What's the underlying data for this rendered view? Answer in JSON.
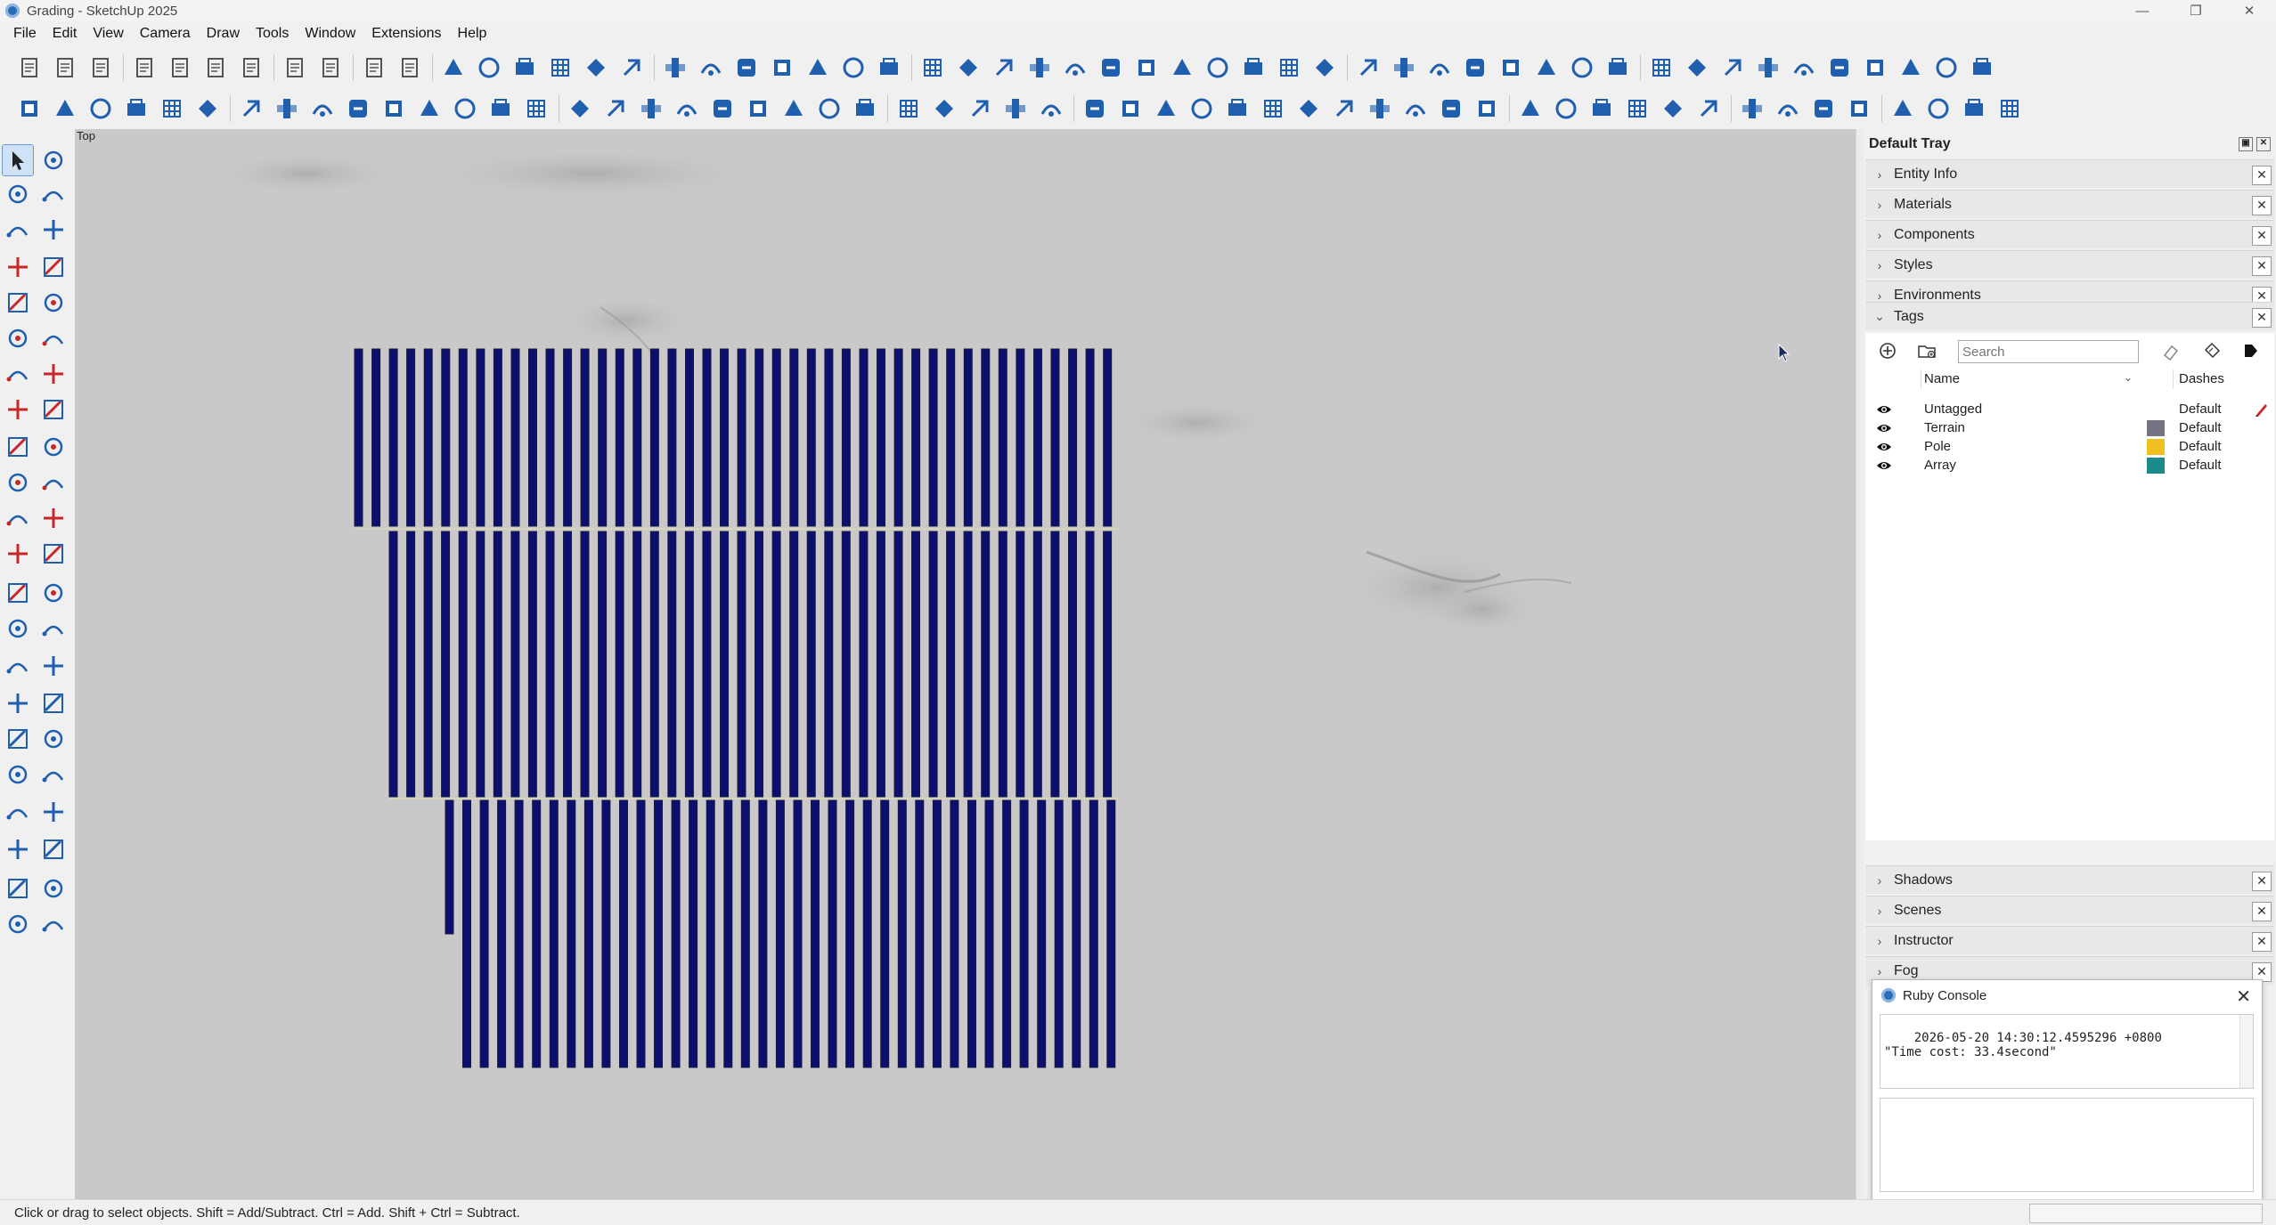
{
  "window": {
    "title": "Grading - SketchUp 2025",
    "minimize": "—",
    "restore": "❐",
    "close": "✕"
  },
  "menu": [
    "File",
    "Edit",
    "View",
    "Camera",
    "Draw",
    "Tools",
    "Window",
    "Extensions",
    "Help"
  ],
  "toolbar1_icons": [
    "new-file-icon",
    "open-icon",
    "save-icon",
    "|",
    "cut-icon",
    "copy-icon",
    "paste-icon",
    "erase-icon",
    "|",
    "undo-icon",
    "redo-icon",
    "|",
    "print-icon",
    "model-info-icon",
    "|",
    "iso-view-icon",
    "top-view-icon",
    "front-view-icon",
    "right-view-icon",
    "back-view-icon",
    "left-view-icon",
    "|",
    "xray-icon",
    "back-edges-icon",
    "wireframe-icon",
    "hidden-line-icon",
    "shaded-icon",
    "shaded-textures-icon",
    "monochrome-icon",
    "|",
    "house-icon",
    "text-icon",
    "tree-icon",
    "tree2-icon",
    "windmill-icon",
    "tower-icon",
    "box-icon",
    "grid-icon",
    "frame-icon",
    "resize-icon",
    "hide-icon",
    "pyramid-icon",
    "|",
    "search-icon",
    "angle-icon",
    "dimension-icon",
    "tape-icon",
    "swap-icon",
    "list-icon",
    "lock-icon",
    "slope-icon",
    "|",
    "terrain-icon",
    "vehicle-icon",
    "table-icon",
    "road-icon",
    "snow-icon",
    "split-icon",
    "auto-icon",
    "flow-icon",
    "map-icon",
    "map2-icon"
  ],
  "toolbar2_icons": [
    "menu-icon",
    "sun-icon",
    "globe-icon",
    "area-icon",
    "mountain-icon",
    "mountains-icon",
    "|",
    "panel-icon",
    "panel2-icon",
    "grid-panel-icon",
    "panel3-icon",
    "trash-icon",
    "percent-icon",
    "wand-icon",
    "wand2-icon",
    "pipe-icon",
    "|",
    "grid2-icon",
    "chip-icon",
    "cable-icon",
    "zoom-pan-icon",
    "wave-icon",
    "zoom-search-icon",
    "earth-icon",
    "link-icon",
    "barcode-icon",
    "|",
    "axis-icon",
    "layers-icon",
    "add-box-icon",
    "cloud-cad-icon",
    "ruler-icon",
    "|",
    "flow-chart-icon",
    "image-edit-icon",
    "pointer-icon",
    "move-cross-icon",
    "calculator-icon",
    "sliders-icon",
    "dropbox-icon",
    "grid-lock-icon",
    "yen-icon",
    "kwh-icon",
    "irr-icon",
    "clipboard-icon",
    "|",
    "gear-icon",
    "group-icon",
    "export-icon",
    "help-icon",
    "cloud-upload-icon",
    "refresh-icon",
    "|",
    "database-icon",
    "loss-icon",
    "bi-icon",
    "play-icon",
    "|",
    "explode-icon",
    "scissors-icon",
    "chart-icon",
    "document-icon"
  ],
  "left_tools": [
    [
      "select-icon",
      "lasso-icon"
    ],
    [
      "paint-icon",
      "eraser-icon"
    ],
    [
      "component-icon",
      "tag-eraser-icon"
    ],
    [
      "pencil-icon",
      "freehand-icon"
    ],
    [
      "rectangle-icon",
      "rotated-rect-icon"
    ],
    [
      "circle-icon",
      "polygon-icon"
    ],
    [
      "arc-icon",
      "arc2-icon"
    ],
    [
      "pie-icon",
      "arc3-icon"
    ],
    [
      "move-icon",
      "push-pull-icon"
    ],
    [
      "rotate-icon",
      "follow-me-icon"
    ],
    [
      "scale-icon",
      "offset-icon"
    ],
    [
      "flip-icon",
      "mirror-icon"
    ],
    [
      "tape-measure-icon",
      "dimension-tool-icon"
    ],
    [
      "protractor-icon",
      "label-icon"
    ],
    [
      "axes-icon",
      "3d-text-icon"
    ],
    [
      "section-plane-icon",
      "pan-hand-icon"
    ],
    [
      "zoom-icon",
      "zoom-window-icon"
    ],
    [
      "zoom-extents-icon",
      "previous-view-icon"
    ],
    [
      "position-camera-icon",
      "walk-icon"
    ],
    [
      "look-around-icon",
      "speaker-icon"
    ],
    [
      "sandbox-icon",
      "sandbox2-icon"
    ],
    [
      "layers-stack-icon",
      "stamp-icon"
    ]
  ],
  "viewport": {
    "label": "Top"
  },
  "scene": {
    "array_color": "#0b0f6e",
    "background": "#c9c9c9"
  },
  "tray": {
    "title": "Default Tray",
    "panels_top": [
      "Entity Info",
      "Materials",
      "Components",
      "Styles",
      "Environments"
    ],
    "tags_panel": "Tags",
    "panels_bottom": [
      "Shadows",
      "Scenes",
      "Instructor",
      "Fog"
    ],
    "close_symbol": "✕",
    "collapsed_chevron": "›",
    "expanded_chevron": "⌄"
  },
  "tags": {
    "search_placeholder": "Search",
    "col_name": "Name",
    "col_dashes": "Dashes",
    "rows": [
      {
        "name": "Untagged",
        "dashes": "Default",
        "color": ""
      },
      {
        "name": "Terrain",
        "dashes": "Default",
        "color": "#737382"
      },
      {
        "name": "Pole",
        "dashes": "Default",
        "color": "#f0c020"
      },
      {
        "name": "Array",
        "dashes": "Default",
        "color": "#1a8a8a"
      }
    ]
  },
  "ruby_console": {
    "title": "Ruby Console",
    "output": "2026-05-20 14:30:12.4595296 +0800\n\"Time cost: 33.4second\"",
    "close": "✕"
  },
  "status": {
    "text": "Click or drag to select objects. Shift = Add/Subtract. Ctrl = Add. Shift + Ctrl = Subtract."
  },
  "colors": {
    "accent": "#1565c0",
    "toolbar_icon": "#1f5fae"
  }
}
